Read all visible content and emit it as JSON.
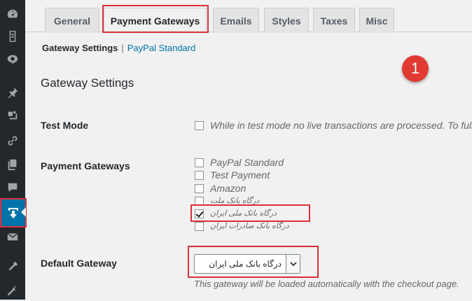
{
  "sidebar": {
    "icons": [
      "dashboard-icon",
      "media-icon",
      "comments-icon",
      "pin-icon",
      "media-library-icon",
      "links-icon",
      "pages-icon",
      "speech-bubble-icon",
      "download-plugin-icon",
      "mail-icon",
      "tools-icon",
      "settings-icon"
    ]
  },
  "tabs": [
    "General",
    "Payment Gateways",
    "Emails",
    "Styles",
    "Taxes",
    "Misc"
  ],
  "active_tab": "Payment Gateways",
  "subnav": {
    "current": "Gateway Settings",
    "separator": "|",
    "link": "PayPal Standard"
  },
  "badge": "1",
  "section_title": "Gateway Settings",
  "test_mode": {
    "label": "Test Mode",
    "description": "While in test mode no live transactions are processed. To fully u",
    "checked": false
  },
  "payment_gateways": {
    "label": "Payment Gateways",
    "options": [
      {
        "label": "PayPal Standard",
        "checked": false
      },
      {
        "label": "Test Payment",
        "checked": false
      },
      {
        "label": "Amazon",
        "checked": false
      },
      {
        "label": "درگاه بانک ملت",
        "checked": false
      },
      {
        "label": "درگاه بانک ملی ایران",
        "checked": true
      },
      {
        "label": "درگاه بانک صادرات ایران",
        "checked": false
      }
    ]
  },
  "default_gateway": {
    "label": "Default Gateway",
    "selected": "درگاه بانک ملی ایران",
    "description": "This gateway will be loaded automatically with the checkout page."
  },
  "colors": {
    "sidebar": "#23282d",
    "active_menu": "#0073aa",
    "highlight": "#d9303a",
    "badge": "#e03a33",
    "link": "#0073aa"
  }
}
